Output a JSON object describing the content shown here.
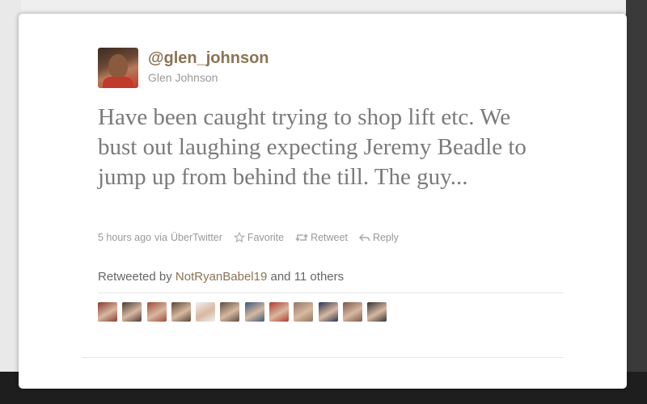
{
  "tweet": {
    "screen_name": "@glen_johnson",
    "full_name": "Glen Johnson",
    "text": "Have been caught trying to shop lift etc. We bust out laughing expecting Jeremy Beadle to jump up from behind the till. The guy...",
    "timestamp": "5 hours ago",
    "via_prefix": "via",
    "source": "ÜberTwitter"
  },
  "actions": {
    "favorite": "Favorite",
    "retweet": "Retweet",
    "reply": "Reply"
  },
  "retweets": {
    "prefix": "Retweeted by",
    "user": "NotRyanBabel19",
    "suffix": "and 11 others",
    "avatar_colors": [
      "#8b3a2f",
      "#4a3c34",
      "#a14a3a",
      "#5a4636",
      "#f0f0f0",
      "#5c4d44",
      "#3a5a7a",
      "#b23a2f",
      "#8f7866",
      "#2a3550",
      "#7a5a4c",
      "#333333"
    ]
  },
  "colors": {
    "accent": "#8b7355",
    "muted": "#999999",
    "text": "#7a7a7a"
  }
}
